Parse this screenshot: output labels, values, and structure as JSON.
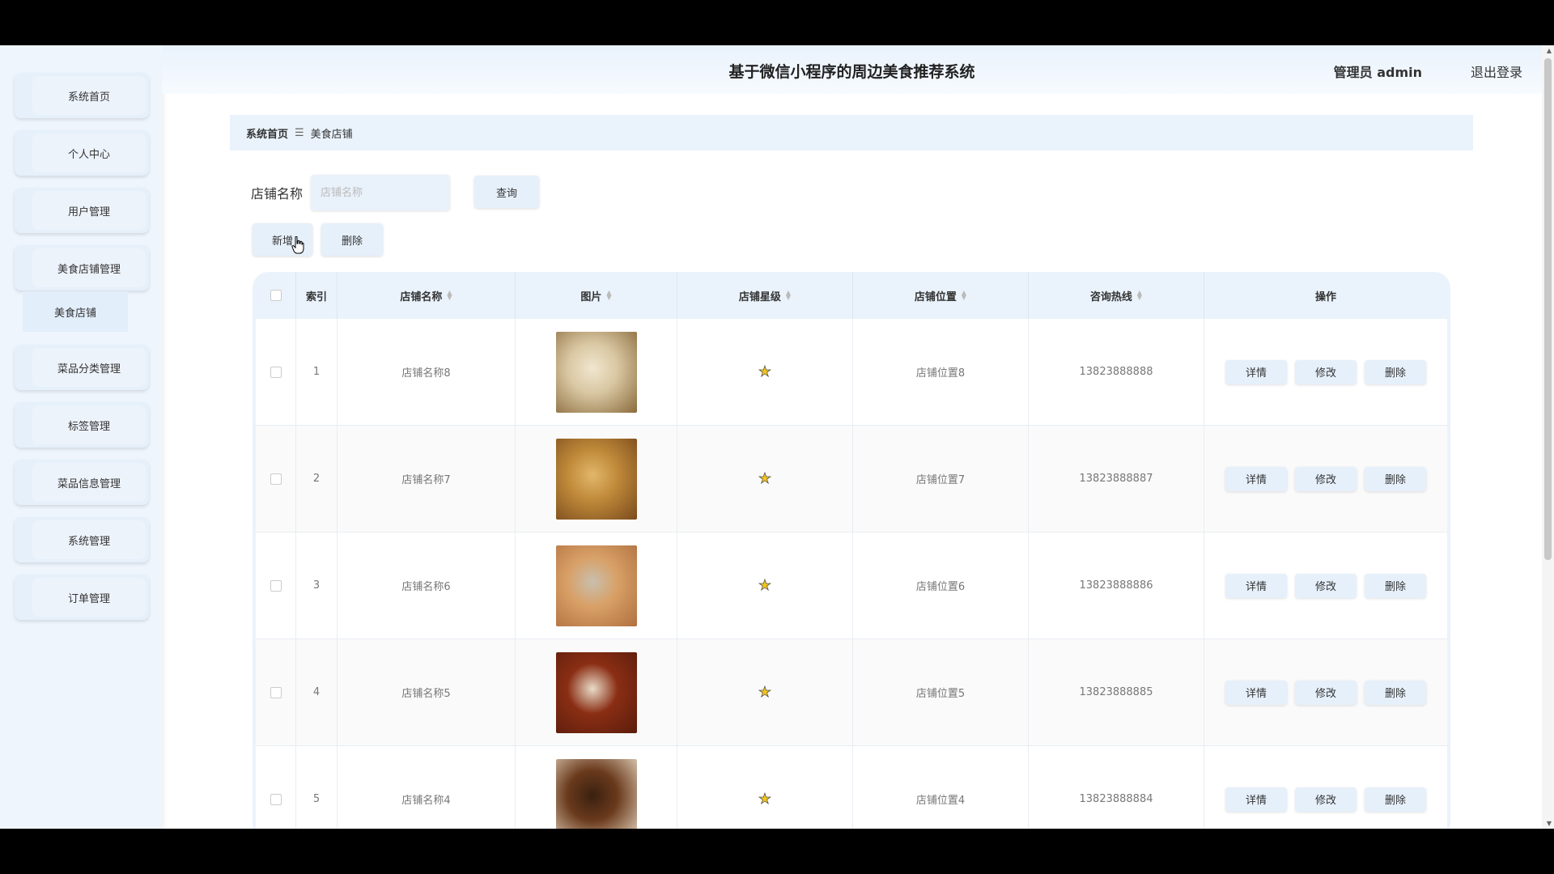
{
  "header": {
    "title": "基于微信小程序的周边美食推荐系统",
    "user": "管理员 admin",
    "logout": "退出登录"
  },
  "sidebar": {
    "items": [
      {
        "label": "系统首页"
      },
      {
        "label": "个人中心"
      },
      {
        "label": "用户管理"
      },
      {
        "label": "美食店铺管理"
      },
      {
        "label": "菜品分类管理"
      },
      {
        "label": "标签管理"
      },
      {
        "label": "菜品信息管理"
      },
      {
        "label": "系统管理"
      },
      {
        "label": "订单管理"
      }
    ],
    "submenu": {
      "label": "美食店铺"
    }
  },
  "breadcrumb": {
    "home": "系统首页",
    "separator": "☰",
    "current": "美食店铺"
  },
  "search": {
    "label": "店铺名称",
    "placeholder": "店铺名称",
    "query_button": "查询"
  },
  "toolbar": {
    "add_button": "新增",
    "delete_button": "删除"
  },
  "table": {
    "columns": {
      "index": "索引",
      "name": "店铺名称",
      "image": "图片",
      "stars": "店铺星级",
      "location": "店铺位置",
      "phone": "咨询热线",
      "actions": "操作"
    },
    "rows": [
      {
        "index": "1",
        "name": "店铺名称8",
        "star_icon": "star-icon",
        "location": "店铺位置8",
        "phone": "13823888888",
        "image_colors": [
          "#d9c7a2",
          "#8a6a3c",
          "#f1e6cf"
        ]
      },
      {
        "index": "2",
        "name": "店铺名称7",
        "star_icon": "star-icon",
        "location": "店铺位置7",
        "phone": "13823888887",
        "image_colors": [
          "#c08a3a",
          "#7a4a1c",
          "#e2b76a"
        ]
      },
      {
        "index": "3",
        "name": "店铺名称6",
        "star_icon": "star-icon",
        "location": "店铺位置6",
        "phone": "13823888886",
        "image_colors": [
          "#d8a066",
          "#b07040",
          "#c9bfae"
        ]
      },
      {
        "index": "4",
        "name": "店铺名称5",
        "star_icon": "star-icon",
        "location": "店铺位置5",
        "phone": "13823888885",
        "image_colors": [
          "#8a2e14",
          "#5a1c0c",
          "#e9dcc8"
        ]
      },
      {
        "index": "5",
        "name": "店铺名称4",
        "star_icon": "star-icon",
        "location": "店铺位置4",
        "phone": "13823888884",
        "image_colors": [
          "#6a3a1c",
          "#e6d6c0",
          "#3a2010"
        ]
      }
    ],
    "row_actions": {
      "detail": "详情",
      "edit": "修改",
      "delete": "删除"
    }
  },
  "colors": {
    "sidebar_bg": "#eef5fd",
    "button_bg": "#e6f0fb",
    "star": "#f5c518"
  }
}
